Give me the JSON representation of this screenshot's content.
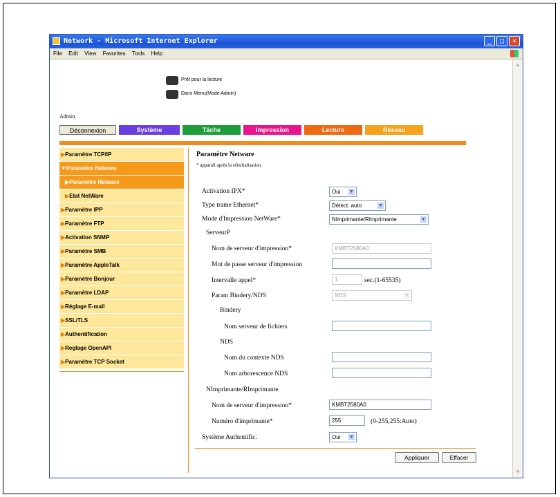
{
  "window": {
    "title": "Network - Microsoft Internet Explorer",
    "minimize": "_",
    "maximize": "□",
    "close": "✕"
  },
  "menu": [
    "File",
    "Edit",
    "View",
    "Favorites",
    "Tools",
    "Help"
  ],
  "status": {
    "ready": "Prêt pour la lecture",
    "mode": "Dans Menu(Mode Admin)"
  },
  "admin_label": "Admin.",
  "tabs": {
    "logout": "Déconnexion",
    "items": [
      {
        "label": "Système",
        "color": "#6b3fe0"
      },
      {
        "label": "Tâche",
        "color": "#1e9e3a"
      },
      {
        "label": "Impression",
        "color": "#e8168a"
      },
      {
        "label": "Lecture",
        "color": "#ee6a12"
      },
      {
        "label": "Réseau",
        "color": "#f5a21c"
      }
    ]
  },
  "sidebar": [
    {
      "label": "Paramètre TCP/IP",
      "marker": "▶"
    },
    {
      "label": "Paramètre Netware",
      "marker": "▼"
    },
    {
      "label": "Paramètre Netware",
      "marker": "▶"
    },
    {
      "label": "Etat NetWare",
      "marker": "▶"
    },
    {
      "label": "Paramètre IPP",
      "marker": "▶"
    },
    {
      "label": "Paramètre FTP",
      "marker": "▶"
    },
    {
      "label": "Activation SNMP",
      "marker": "▶"
    },
    {
      "label": "Paramètre SMB",
      "marker": "▶"
    },
    {
      "label": "Paramètre AppleTalk",
      "marker": "▶"
    },
    {
      "label": "Paramètre Bonjour",
      "marker": "▶"
    },
    {
      "label": "Paramètre LDAP",
      "marker": "▶"
    },
    {
      "label": "Réglage E-mail",
      "marker": "▶"
    },
    {
      "label": "SSL/TLS",
      "marker": "▶"
    },
    {
      "label": "Authentification",
      "marker": "▶"
    },
    {
      "label": "Reglage OpenAPI",
      "marker": "▶"
    },
    {
      "label": "Paramètre TCP Socket",
      "marker": "▶"
    }
  ],
  "panel": {
    "title": "Paramètre Netware",
    "note": "* apparaît après la réinitialisation."
  },
  "form": {
    "ipx": {
      "label": "Activation IPX*",
      "value": "Oui"
    },
    "frame_type": {
      "label": "Type trame Ethernet*",
      "value": "Détect. auto"
    },
    "print_mode": {
      "label": "Mode d'Impression NetWare*",
      "value": "NImprimante/RImprimante"
    },
    "pserver_heading": "ServeurP",
    "ps_name": {
      "label": "Nom de serveur d'impression*",
      "value": "KMBT2580A0"
    },
    "ps_password": {
      "label": "Mot de passe serveur d'impression",
      "value": ""
    },
    "poll_interval": {
      "label": "Intervalle appel*",
      "value": "1",
      "unit": "sec.(1-65535)"
    },
    "bindery_nds": {
      "label": "Param Bindery/NDS",
      "value": "NDS"
    },
    "bindery_heading": "Bindery",
    "file_server": {
      "label": "Nom serveur de fichiers",
      "value": ""
    },
    "nds_heading": "NDS",
    "nds_context": {
      "label": "Nom du contexte NDS",
      "value": ""
    },
    "nds_tree": {
      "label": "Nom arborescence NDS",
      "value": ""
    },
    "nprinter_heading": "NImprimante/RImprimante",
    "np_server": {
      "label": "Nom de serveur d'impression*",
      "value": "KMBT2580A0"
    },
    "np_number": {
      "label": "Numéro d'imprimante*",
      "value": "255",
      "range": "(0-255,255:Auto)"
    },
    "auth_system": {
      "label": "Système Authentific.",
      "value": "Oui"
    }
  },
  "buttons": {
    "apply": "Appliquer",
    "clear": "Effacer"
  }
}
